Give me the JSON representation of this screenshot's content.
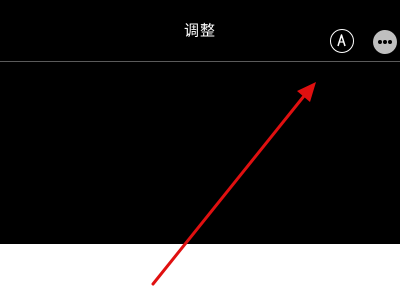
{
  "header": {
    "title": "调整",
    "left_icon": "markup-pen-icon",
    "right_icon": "more-ellipsis-icon"
  },
  "colors": {
    "background": "#000000",
    "title_text": "#ffffff",
    "more_button_fill": "#bfbfbf",
    "divider": "#5a5a5a",
    "photo": "#ffffff",
    "annotation_arrow": "#e01010"
  }
}
